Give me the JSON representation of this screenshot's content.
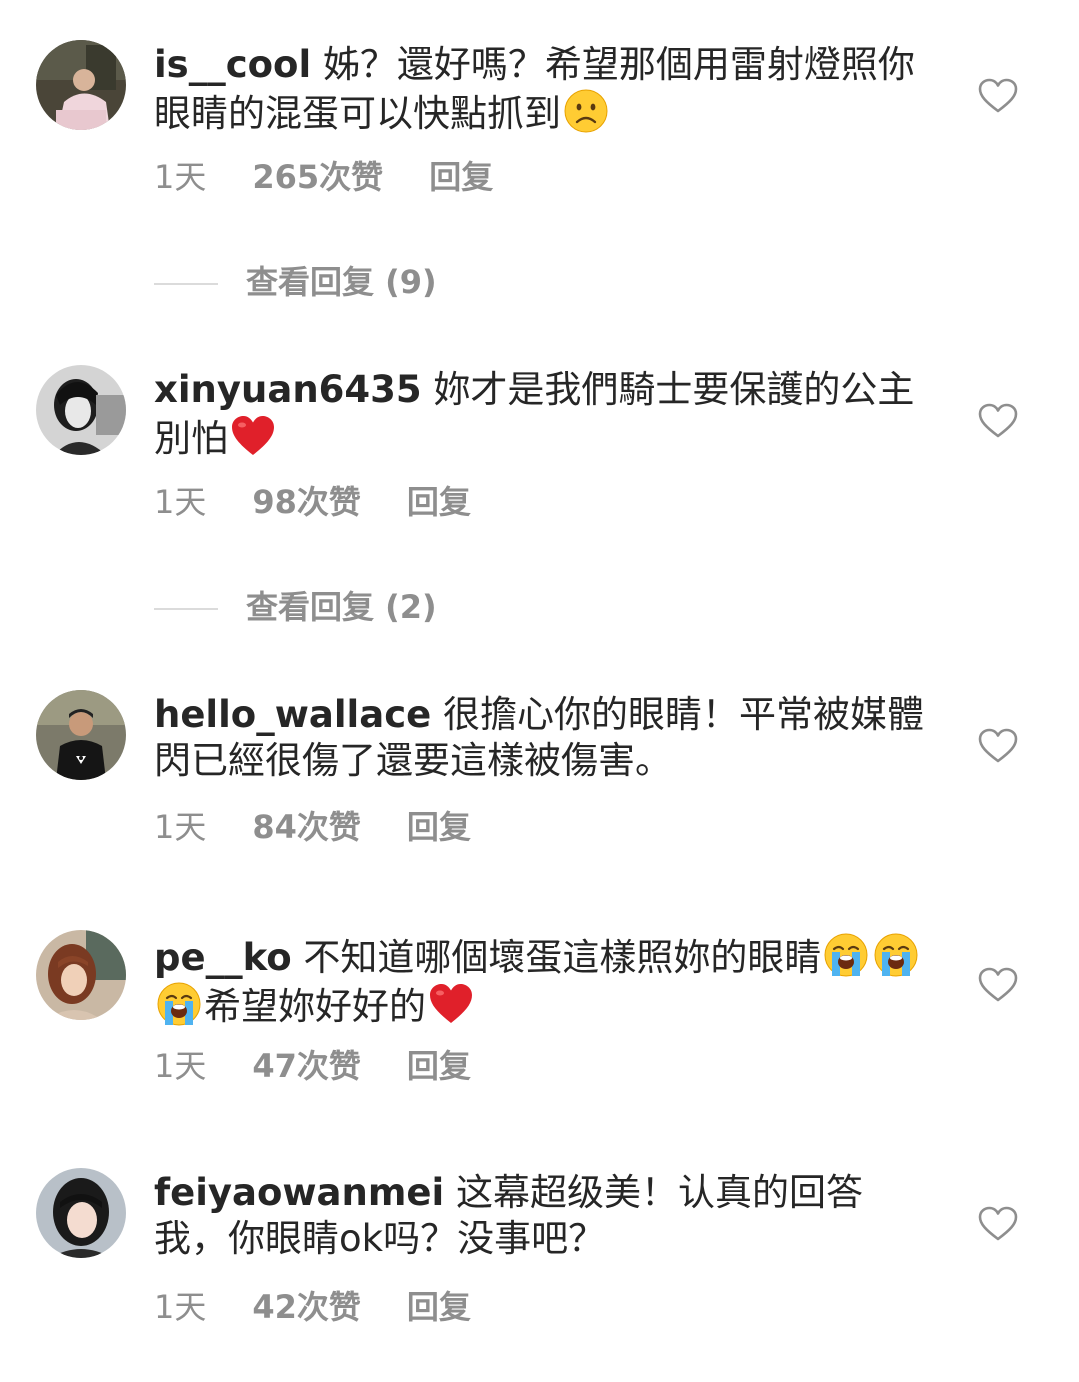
{
  "comments": [
    {
      "username": "is__cool",
      "text": "姊？還好嗎？希望那個用雷射燈照你眼睛的混蛋可以快點抓到",
      "emoji_after": [
        "frowning-face"
      ],
      "time": "1天",
      "likes": "265次赞",
      "reply": "回复",
      "view_replies": "查看回复 (9)"
    },
    {
      "username": "xinyuan6435",
      "text": "妳才是我們騎士要保護的公主 別怕",
      "emoji_after": [
        "red-heart"
      ],
      "time": "1天",
      "likes": "98次赞",
      "reply": "回复",
      "view_replies": "查看回复 (2)"
    },
    {
      "username": "hello_wallace",
      "text": "很擔心你的眼睛！平常被媒體閃已經很傷了還要這樣被傷害。",
      "time": "1天",
      "likes": "84次赞",
      "reply": "回复"
    },
    {
      "username": "pe__ko",
      "text": "不知道哪個壞蛋這樣照妳的眼睛",
      "emoji_mid": [
        "loudly-crying-face",
        "loudly-crying-face",
        "loudly-crying-face"
      ],
      "text2": "希望妳好好的",
      "emoji_after": [
        "red-heart"
      ],
      "time": "1天",
      "likes": "47次赞",
      "reply": "回复"
    },
    {
      "username": "feiyaowanmei",
      "text": "这幕超级美！认真的回答我，你眼睛ok吗？没事吧？",
      "time": "1天",
      "likes": "42次赞",
      "reply": "回复"
    }
  ],
  "icons": {
    "like": "heart-outline-icon"
  },
  "colors": {
    "text": "#262626",
    "secondary": "#8e8e8e",
    "divider": "#dbdbdb",
    "heart_emoji": "#e0202a"
  }
}
